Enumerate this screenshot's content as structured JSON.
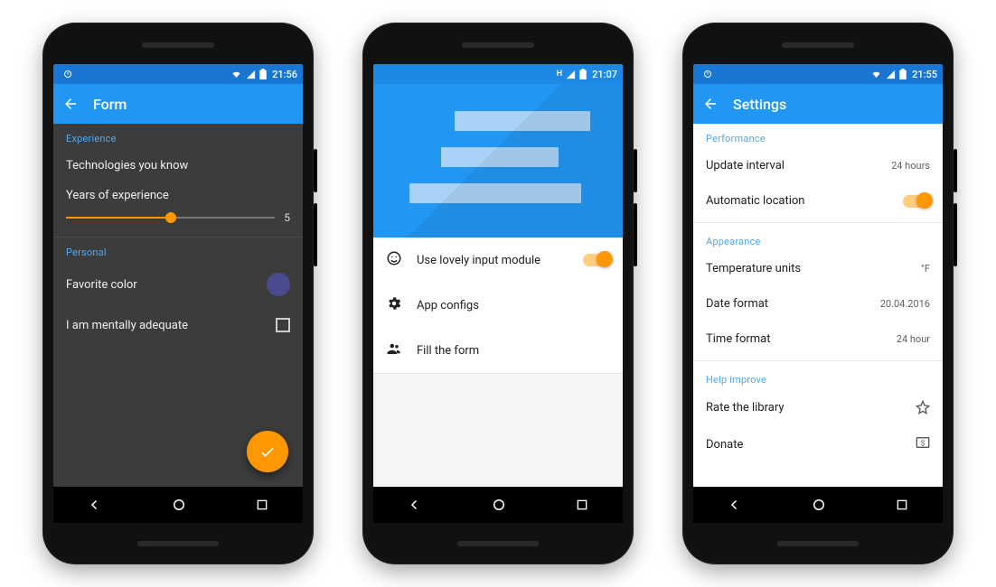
{
  "phone1": {
    "status_time": "21:56",
    "appbar_title": "Form",
    "section_experience": "Experience",
    "technologies_label": "Technologies you know",
    "years_label": "Years of experience",
    "years_value": "5",
    "section_personal": "Personal",
    "favcolor_label": "Favorite color",
    "favcolor_value": "#4a4a8f",
    "mentally_label": "I am mentally adequate"
  },
  "phone2": {
    "status_time": "21:07",
    "items": {
      "lovely": "Use lovely input module",
      "configs": "App configs",
      "fill": "Fill the form"
    }
  },
  "phone3": {
    "status_time": "21:55",
    "appbar_title": "Settings",
    "section_performance": "Performance",
    "update_label": "Update interval",
    "update_value": "24 hours",
    "autoloc_label": "Automatic location",
    "section_appearance": "Appearance",
    "temp_label": "Temperature units",
    "temp_value": "°F",
    "date_label": "Date format",
    "date_value": "20.04.2016",
    "time_label": "Time format",
    "time_value": "24 hour",
    "section_help": "Help improve",
    "rate_label": "Rate the library",
    "donate_label": "Donate"
  },
  "colors": {
    "primary": "#2196f3",
    "primary_dark": "#1976d2",
    "accent": "#ff9800"
  }
}
